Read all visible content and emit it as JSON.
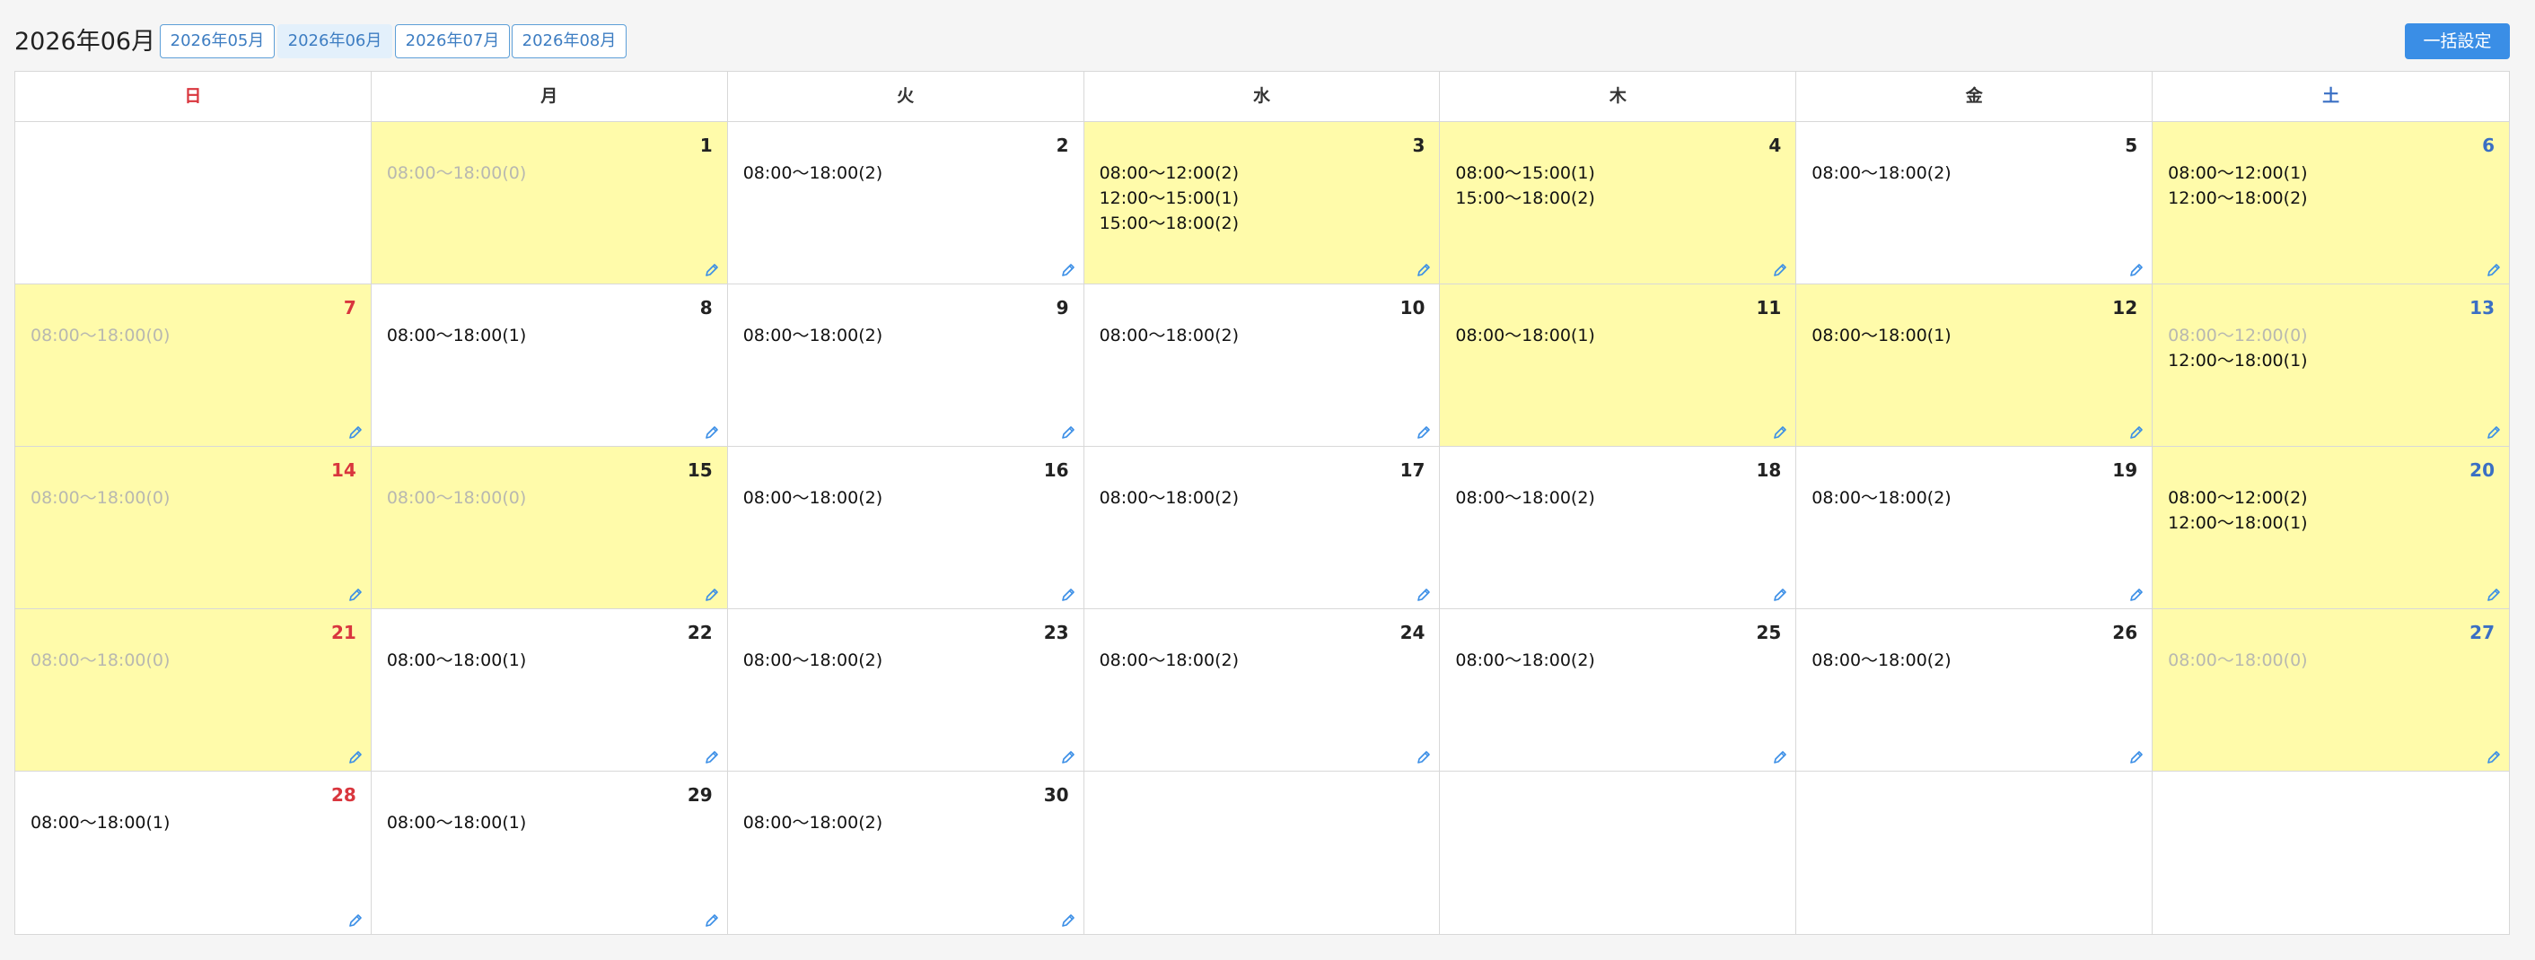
{
  "header": {
    "title": "2026年06月",
    "month_buttons": [
      {
        "label": "2026年05月",
        "active": false
      },
      {
        "label": "2026年06月",
        "active": true
      },
      {
        "label": "2026年07月",
        "active": false
      },
      {
        "label": "2026年08月",
        "active": false
      }
    ],
    "bulk_label": "一括設定"
  },
  "weekdays": [
    "日",
    "月",
    "火",
    "水",
    "木",
    "金",
    "土"
  ],
  "colors": {
    "sunday": "#d9363e",
    "saturday": "#3a6fc4",
    "highlight": "#fffbaa",
    "muted_text": "#b8b8b0",
    "accent": "#3a8ee6"
  },
  "weeks": [
    [
      null,
      {
        "day": "1",
        "hl": true,
        "slots": [
          {
            "text": "08:00〜18:00(0)",
            "muted": true
          }
        ]
      },
      {
        "day": "2",
        "hl": false,
        "slots": [
          {
            "text": "08:00〜18:00(2)",
            "muted": false
          }
        ]
      },
      {
        "day": "3",
        "hl": true,
        "slots": [
          {
            "text": "08:00〜12:00(2)",
            "muted": false
          },
          {
            "text": "12:00〜15:00(1)",
            "muted": false
          },
          {
            "text": "15:00〜18:00(2)",
            "muted": false
          }
        ]
      },
      {
        "day": "4",
        "hl": true,
        "slots": [
          {
            "text": "08:00〜15:00(1)",
            "muted": false
          },
          {
            "text": "15:00〜18:00(2)",
            "muted": false
          }
        ]
      },
      {
        "day": "5",
        "hl": false,
        "slots": [
          {
            "text": "08:00〜18:00(2)",
            "muted": false
          }
        ]
      },
      {
        "day": "6",
        "hl": true,
        "slots": [
          {
            "text": "08:00〜12:00(1)",
            "muted": false
          },
          {
            "text": "12:00〜18:00(2)",
            "muted": false
          }
        ]
      }
    ],
    [
      {
        "day": "7",
        "hl": true,
        "slots": [
          {
            "text": "08:00〜18:00(0)",
            "muted": true
          }
        ]
      },
      {
        "day": "8",
        "hl": false,
        "slots": [
          {
            "text": "08:00〜18:00(1)",
            "muted": false
          }
        ]
      },
      {
        "day": "9",
        "hl": false,
        "slots": [
          {
            "text": "08:00〜18:00(2)",
            "muted": false
          }
        ]
      },
      {
        "day": "10",
        "hl": false,
        "slots": [
          {
            "text": "08:00〜18:00(2)",
            "muted": false
          }
        ]
      },
      {
        "day": "11",
        "hl": true,
        "slots": [
          {
            "text": "08:00〜18:00(1)",
            "muted": false
          }
        ]
      },
      {
        "day": "12",
        "hl": true,
        "slots": [
          {
            "text": "08:00〜18:00(1)",
            "muted": false
          }
        ]
      },
      {
        "day": "13",
        "hl": true,
        "slots": [
          {
            "text": "08:00〜12:00(0)",
            "muted": true
          },
          {
            "text": "12:00〜18:00(1)",
            "muted": false
          }
        ]
      }
    ],
    [
      {
        "day": "14",
        "hl": true,
        "slots": [
          {
            "text": "08:00〜18:00(0)",
            "muted": true
          }
        ]
      },
      {
        "day": "15",
        "hl": true,
        "slots": [
          {
            "text": "08:00〜18:00(0)",
            "muted": true
          }
        ]
      },
      {
        "day": "16",
        "hl": false,
        "slots": [
          {
            "text": "08:00〜18:00(2)",
            "muted": false
          }
        ]
      },
      {
        "day": "17",
        "hl": false,
        "slots": [
          {
            "text": "08:00〜18:00(2)",
            "muted": false
          }
        ]
      },
      {
        "day": "18",
        "hl": false,
        "slots": [
          {
            "text": "08:00〜18:00(2)",
            "muted": false
          }
        ]
      },
      {
        "day": "19",
        "hl": false,
        "slots": [
          {
            "text": "08:00〜18:00(2)",
            "muted": false
          }
        ]
      },
      {
        "day": "20",
        "hl": true,
        "slots": [
          {
            "text": "08:00〜12:00(2)",
            "muted": false
          },
          {
            "text": "12:00〜18:00(1)",
            "muted": false
          }
        ]
      }
    ],
    [
      {
        "day": "21",
        "hl": true,
        "slots": [
          {
            "text": "08:00〜18:00(0)",
            "muted": true
          }
        ]
      },
      {
        "day": "22",
        "hl": false,
        "slots": [
          {
            "text": "08:00〜18:00(1)",
            "muted": false
          }
        ]
      },
      {
        "day": "23",
        "hl": false,
        "slots": [
          {
            "text": "08:00〜18:00(2)",
            "muted": false
          }
        ]
      },
      {
        "day": "24",
        "hl": false,
        "slots": [
          {
            "text": "08:00〜18:00(2)",
            "muted": false
          }
        ]
      },
      {
        "day": "25",
        "hl": false,
        "slots": [
          {
            "text": "08:00〜18:00(2)",
            "muted": false
          }
        ]
      },
      {
        "day": "26",
        "hl": false,
        "slots": [
          {
            "text": "08:00〜18:00(2)",
            "muted": false
          }
        ]
      },
      {
        "day": "27",
        "hl": true,
        "slots": [
          {
            "text": "08:00〜18:00(0)",
            "muted": true
          }
        ]
      }
    ],
    [
      {
        "day": "28",
        "hl": false,
        "slots": [
          {
            "text": "08:00〜18:00(1)",
            "muted": false
          }
        ]
      },
      {
        "day": "29",
        "hl": false,
        "slots": [
          {
            "text": "08:00〜18:00(1)",
            "muted": false
          }
        ]
      },
      {
        "day": "30",
        "hl": false,
        "slots": [
          {
            "text": "08:00〜18:00(2)",
            "muted": false
          }
        ]
      },
      null,
      null,
      null,
      null
    ]
  ]
}
